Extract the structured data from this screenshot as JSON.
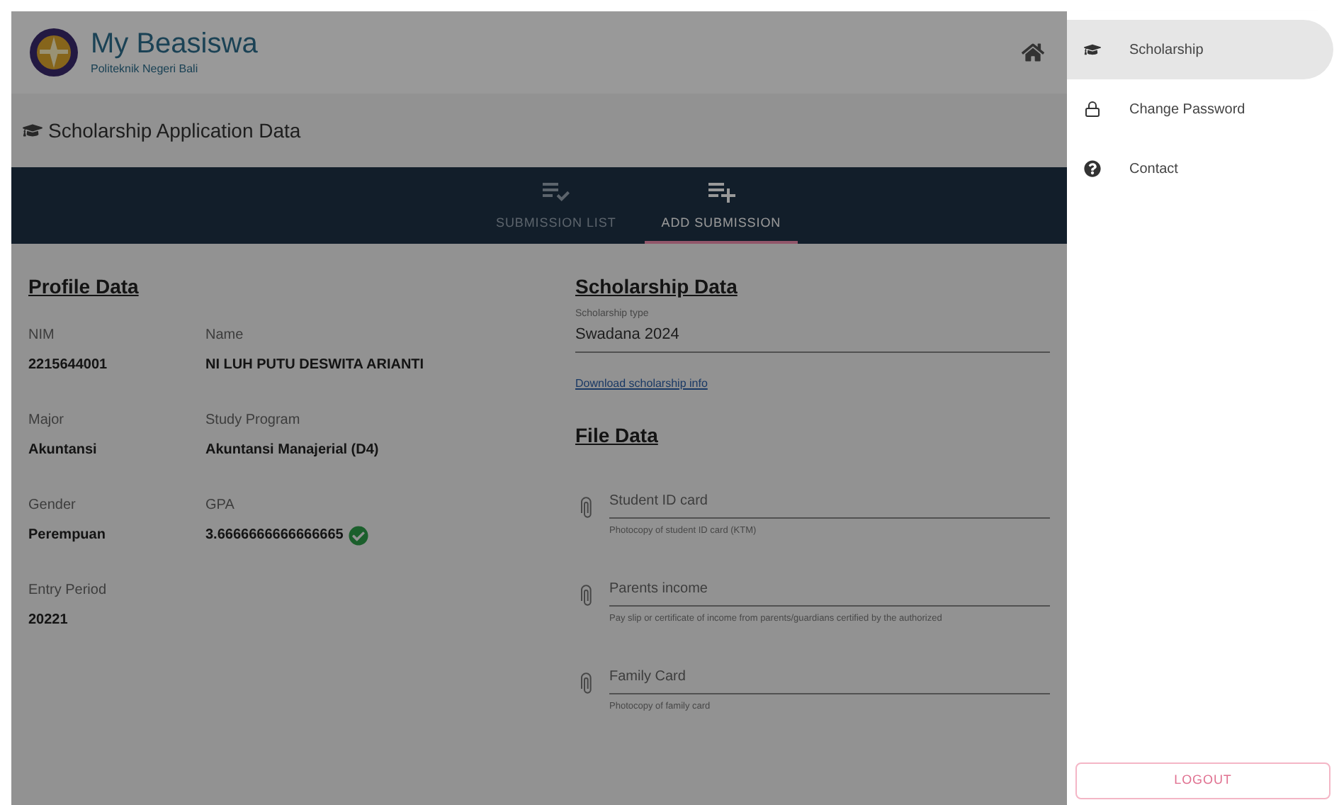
{
  "header": {
    "title": "My Beasiswa",
    "subtitle": "Politeknik Negeri Bali"
  },
  "page_title": "Scholarship Application Data",
  "tabs": [
    {
      "label": "SUBMISSION LIST",
      "kind": "list",
      "selected": false
    },
    {
      "label": "ADD SUBMISSION",
      "kind": "add",
      "selected": true
    }
  ],
  "profile": {
    "heading": "Profile Data",
    "fields": [
      {
        "label": "NIM",
        "value": "2215644001"
      },
      {
        "label": "Name",
        "value": "NI LUH PUTU DESWITA ARIANTI"
      },
      {
        "label": "Major",
        "value": "Akuntansi"
      },
      {
        "label": "Study Program",
        "value": "Akuntansi Manajerial (D4)"
      },
      {
        "label": "Gender",
        "value": "Perempuan"
      },
      {
        "label": "GPA",
        "value": "3.6666666666666665",
        "verified": true
      },
      {
        "label": "Entry Period",
        "value": "20221"
      }
    ]
  },
  "scholarship": {
    "heading": "Scholarship Data",
    "type_label": "Scholarship type",
    "type_value": "Swadana 2024",
    "link": "Download scholarship info"
  },
  "files": {
    "heading": "File Data",
    "items": [
      {
        "label": "Student ID card",
        "hint": "Photocopy of student ID card (KTM)"
      },
      {
        "label": "Parents income",
        "hint": "Pay slip or certificate of income from parents/guardians certified by the authorized"
      },
      {
        "label": "Family Card",
        "hint": "Photocopy of family card"
      }
    ]
  },
  "drawer": {
    "items": [
      {
        "label": "Scholarship",
        "kind": "cap",
        "selected": true
      },
      {
        "label": "Change Password",
        "kind": "lock",
        "selected": false
      },
      {
        "label": "Contact",
        "kind": "help",
        "selected": false
      }
    ],
    "logout": "LOGOUT"
  }
}
